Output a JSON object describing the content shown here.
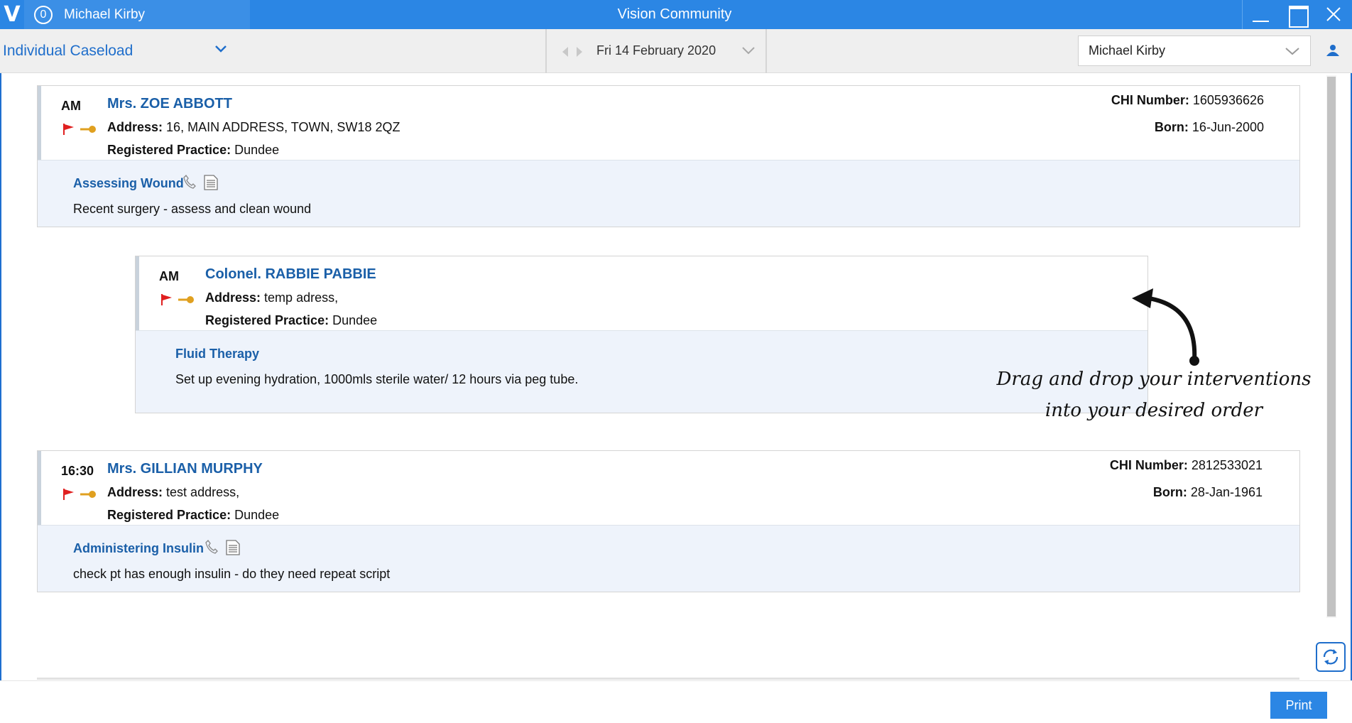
{
  "titlebar": {
    "logo": "V",
    "notification_count": "0",
    "user_name": "Michael Kirby",
    "app_title": "Vision Community"
  },
  "toolbar": {
    "caseload": "Individual Caseload",
    "date": "Fri 14 February 2020",
    "selected_user": "Michael Kirby"
  },
  "visits": [
    {
      "time": "AM",
      "name": "Mrs. ZOE ABBOTT",
      "address_label": "Address:",
      "address": "16, MAIN ADDRESS, TOWN, SW18 2QZ",
      "practice_label": "Registered Practice:",
      "practice": "Dundee",
      "chi_label": "CHI Number:",
      "chi": "1605936626",
      "born_label": "Born:",
      "born": "16-Jun-2000",
      "intervention": "Assessing Wound",
      "description": "Recent surgery - assess and clean wound"
    },
    {
      "time": "AM",
      "name": "Colonel. RABBIE PABBIE",
      "address_label": "Address:",
      "address": "temp adress,",
      "practice_label": "Registered Practice:",
      "practice": "Dundee",
      "intervention": "Fluid Therapy",
      "description": "Set up evening hydration, 1000mls sterile water/ 12 hours via peg tube."
    },
    {
      "time": "16:30",
      "name": "Mrs. GILLIAN MURPHY",
      "address_label": "Address:",
      "address": "test address,",
      "practice_label": "Registered Practice:",
      "practice": "Dundee",
      "chi_label": "CHI Number:",
      "chi": "2812533021",
      "born_label": "Born:",
      "born": "28-Jan-1961",
      "intervention": "Administering Insulin",
      "description": "check pt has enough insulin - do they need repeat script"
    }
  ],
  "annotation": {
    "line1": "Drag and drop your interventions",
    "line2": "into your desired order"
  },
  "footer": {
    "print_label": "Print"
  },
  "colors": {
    "titlebar": "#2b86e4",
    "accent_text": "#1a5fa8",
    "intervention_bg": "#eef3fb",
    "flag": "#e02020",
    "key": "#e0a020"
  },
  "icons": [
    "vision-logo-icon",
    "notification-badge-icon",
    "minimize-icon",
    "maximize-icon",
    "close-icon",
    "chevron-down-icon",
    "arrow-left-icon",
    "arrow-right-icon",
    "person-icon",
    "flag-icon",
    "key-icon",
    "phone-icon",
    "document-icon",
    "refresh-icon"
  ]
}
